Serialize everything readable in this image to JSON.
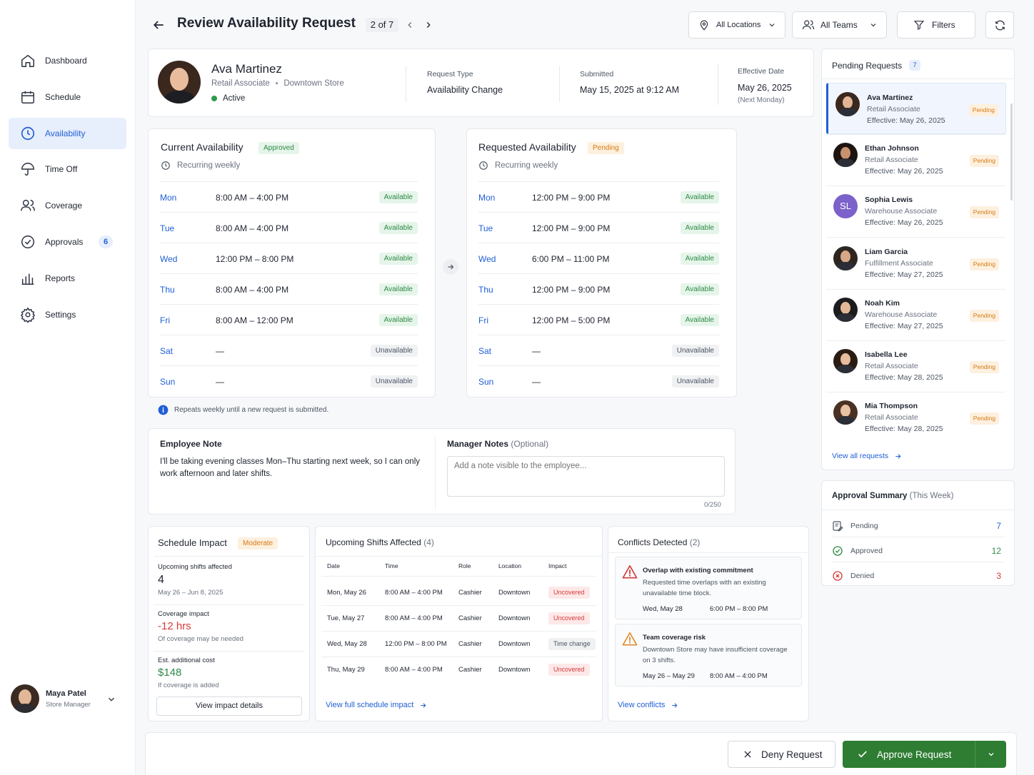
{
  "sidebar": {
    "items": [
      {
        "label": "Dashboard",
        "icon": "home-icon"
      },
      {
        "label": "Schedule",
        "icon": "calendar-icon"
      },
      {
        "label": "Availability",
        "icon": "clock-icon",
        "active": true
      },
      {
        "label": "Time Off",
        "icon": "umbrella-icon"
      },
      {
        "label": "Coverage",
        "icon": "users-icon"
      },
      {
        "label": "Approvals",
        "icon": "check-circle-icon",
        "badge": "6"
      },
      {
        "label": "Reports",
        "icon": "bar-chart-icon"
      },
      {
        "label": "Settings",
        "icon": "gear-icon"
      }
    ],
    "user": {
      "name": "Maya Patel",
      "role": "Store Manager"
    }
  },
  "header": {
    "title": "Review Availability Request",
    "pager": "2 of 7",
    "locations": "All Locations",
    "teams": "All Teams",
    "filters": "Filters"
  },
  "employee": {
    "name": "Ava Martinez",
    "role": "Retail Associate",
    "store": "Downtown Store",
    "status": "Active",
    "request_type_label": "Request Type",
    "request_type": "Availability Change",
    "submitted_label": "Submitted",
    "submitted": "May 15, 2025 at 9:12 AM",
    "effective_label": "Effective Date",
    "effective": "May 26, 2025",
    "effective_note": "(Next Monday)"
  },
  "current": {
    "title": "Current Availability",
    "badge": "Approved",
    "recurring": "Recurring weekly",
    "rows": [
      {
        "day": "Mon",
        "time": "8:00 AM – 4:00 PM",
        "status": "Available"
      },
      {
        "day": "Tue",
        "time": "8:00 AM – 4:00 PM",
        "status": "Available"
      },
      {
        "day": "Wed",
        "time": "12:00 PM – 8:00 PM",
        "status": "Available"
      },
      {
        "day": "Thu",
        "time": "8:00 AM – 4:00 PM",
        "status": "Available"
      },
      {
        "day": "Fri",
        "time": "8:00 AM – 12:00 PM",
        "status": "Available"
      },
      {
        "day": "Sat",
        "time": "—",
        "status": "Unavailable"
      },
      {
        "day": "Sun",
        "time": "—",
        "status": "Unavailable"
      }
    ]
  },
  "requested": {
    "title": "Requested Availability",
    "badge": "Pending",
    "recurring": "Recurring weekly",
    "rows": [
      {
        "day": "Mon",
        "time": "12:00 PM – 9:00 PM",
        "status": "Available"
      },
      {
        "day": "Tue",
        "time": "12:00 PM – 9:00 PM",
        "status": "Available"
      },
      {
        "day": "Wed",
        "time": "6:00 PM – 11:00 PM",
        "status": "Available"
      },
      {
        "day": "Thu",
        "time": "12:00 PM – 9:00 PM",
        "status": "Available"
      },
      {
        "day": "Fri",
        "time": "12:00 PM – 5:00 PM",
        "status": "Available"
      },
      {
        "day": "Sat",
        "time": "—",
        "status": "Unavailable"
      },
      {
        "day": "Sun",
        "time": "—",
        "status": "Unavailable"
      }
    ]
  },
  "repeat_note": "Repeats weekly until a new request is submitted.",
  "notes": {
    "employee_title": "Employee Note",
    "employee_text": "I'll be taking evening classes Mon–Thu starting next week, so I can only work afternoon and later shifts.",
    "manager_title": "Manager Notes",
    "manager_optional": "(Optional)",
    "placeholder": "Add a note visible to the employee...",
    "counter": "0/250"
  },
  "impact": {
    "title": "Schedule Impact",
    "badge": "Moderate",
    "shifts_label": "Upcoming shifts affected",
    "shifts_value": "4",
    "shifts_range": "May 26 – Jun 8, 2025",
    "coverage_label": "Coverage impact",
    "coverage_value": "-12 hrs",
    "coverage_note": "Of coverage may be needed",
    "cost_label": "Est. additional cost",
    "cost_value": "$148",
    "cost_note": "If coverage is added",
    "button": "View impact details"
  },
  "shifts": {
    "title": "Upcoming Shifts Affected",
    "count": "(4)",
    "columns": [
      "Date",
      "Time",
      "Role",
      "Location",
      "Impact"
    ],
    "rows": [
      {
        "date": "Mon, May 26",
        "time": "8:00 AM – 4:00 PM",
        "role": "Cashier",
        "location": "Downtown",
        "impact": "Uncovered"
      },
      {
        "date": "Tue, May 27",
        "time": "8:00 AM – 4:00 PM",
        "role": "Cashier",
        "location": "Downtown",
        "impact": "Uncovered"
      },
      {
        "date": "Wed, May 28",
        "time": "12:00 PM – 8:00 PM",
        "role": "Cashier",
        "location": "Downtown",
        "impact": "Time change"
      },
      {
        "date": "Thu, May 29",
        "time": "8:00 AM – 4:00 PM",
        "role": "Cashier",
        "location": "Downtown",
        "impact": "Uncovered"
      }
    ],
    "link": "View full schedule impact"
  },
  "conflicts": {
    "title": "Conflicts Detected",
    "count": "(2)",
    "items": [
      {
        "title": "Overlap with existing commitment",
        "desc": "Requested time overlaps with an existing unavailable time block.",
        "date": "Wed, May 28",
        "time": "6:00 PM – 8:00 PM",
        "color": "#d63a3a"
      },
      {
        "title": "Team coverage risk",
        "desc": "Downtown Store may have insufficient coverage on 3 shifts.",
        "date": "May 26 – May 29",
        "time": "8:00 AM – 4:00 PM",
        "color": "#e0892a"
      }
    ],
    "link": "View conflicts"
  },
  "pending": {
    "title": "Pending Requests",
    "count": "7",
    "items": [
      {
        "name": "Ava Martinez",
        "role": "Retail Associate",
        "effective": "Effective: May 26, 2025",
        "status": "Pending"
      },
      {
        "name": "Ethan Johnson",
        "role": "Retail Associate",
        "effective": "Effective: May 26, 2025",
        "status": "Pending"
      },
      {
        "name": "Sophia Lewis",
        "role": "Warehouse Associate",
        "effective": "Effective: May 26, 2025",
        "status": "Pending",
        "initials": "SL"
      },
      {
        "name": "Liam Garcia",
        "role": "Fulfillment Associate",
        "effective": "Effective: May 27, 2025",
        "status": "Pending"
      },
      {
        "name": "Noah Kim",
        "role": "Warehouse Associate",
        "effective": "Effective: May 27, 2025",
        "status": "Pending"
      },
      {
        "name": "Isabella Lee",
        "role": "Retail Associate",
        "effective": "Effective: May 28, 2025",
        "status": "Pending"
      },
      {
        "name": "Mia Thompson",
        "role": "Retail Associate",
        "effective": "Effective: May 28, 2025",
        "status": "Pending"
      }
    ],
    "link": "View all requests"
  },
  "summary": {
    "title": "Approval Summary",
    "period": "(This Week)",
    "rows": [
      {
        "label": "Pending",
        "value": "7",
        "color": "#1f5fd6"
      },
      {
        "label": "Approved",
        "value": "12",
        "color": "#2f8a47"
      },
      {
        "label": "Denied",
        "value": "3",
        "color": "#d63a3a"
      }
    ]
  },
  "actions": {
    "deny": "Deny Request",
    "approve": "Approve Request"
  },
  "colors": {
    "accent": "#1f5fd6",
    "approve": "#2e7d32",
    "pending": "#d77a14",
    "danger": "#d63a3a"
  }
}
